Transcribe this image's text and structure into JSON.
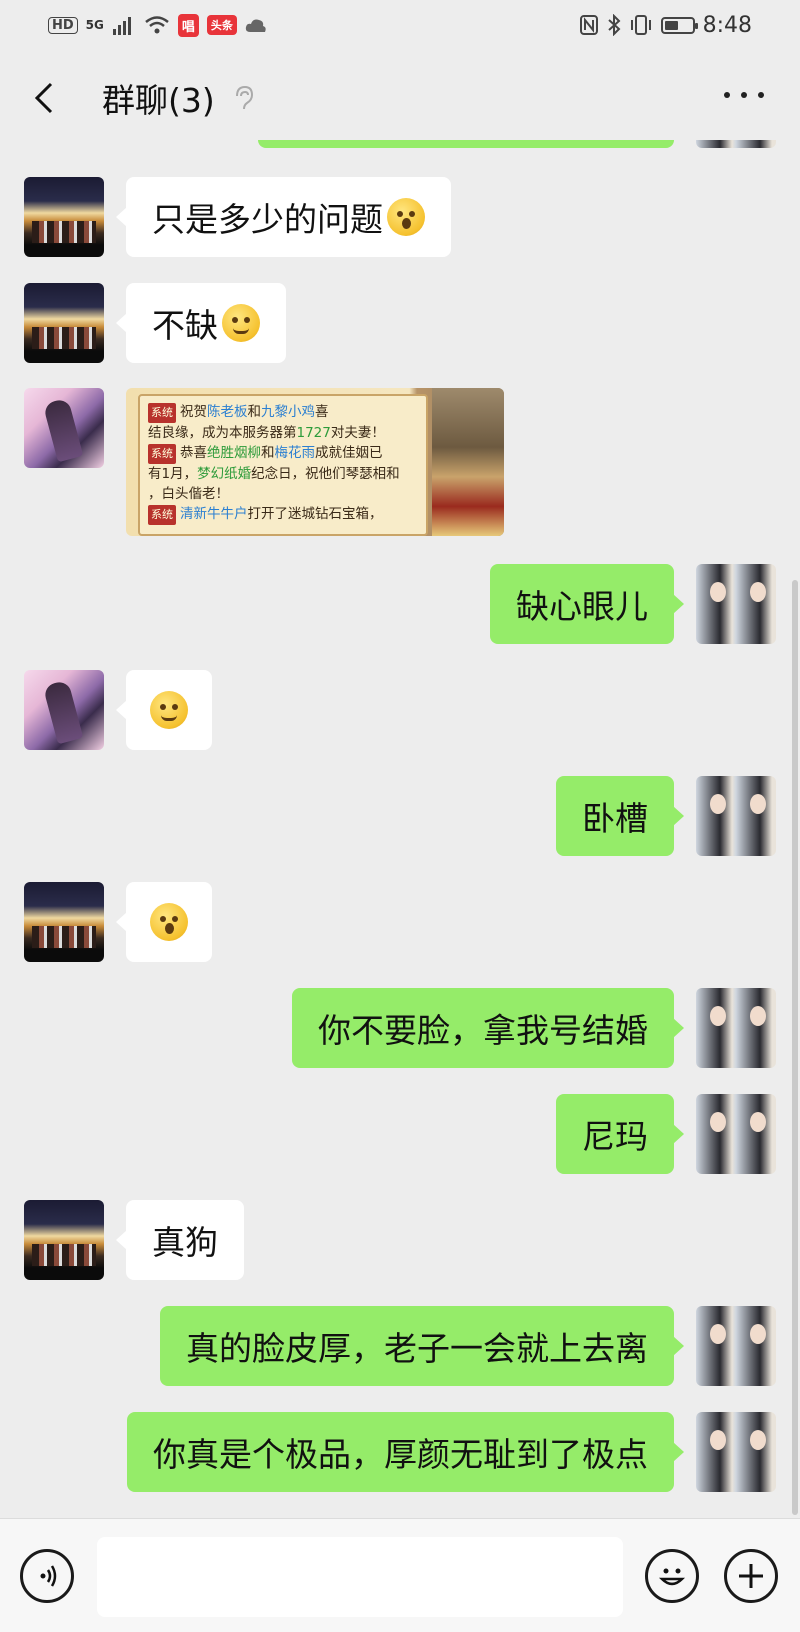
{
  "status_bar": {
    "hd": "HD",
    "net": "5G",
    "app1": "唱",
    "app2": "头条",
    "time": "8:48",
    "battery_level": 0.5
  },
  "header": {
    "title": "群聊(3)"
  },
  "messages": [
    {
      "side": "left",
      "avatar": "group-photo",
      "text": "只是多少的问题",
      "emoji": "surprised-face-icon"
    },
    {
      "side": "left",
      "avatar": "group-photo",
      "text": "不缺",
      "emoji": "smile-face-icon"
    },
    {
      "side": "left",
      "avatar": "anime-avatar",
      "type": "image",
      "image_lines": {
        "l1_tag": "系统",
        "l1a": "祝贺",
        "l1b": "陈老板",
        "l1c": "和",
        "l1d": "九黎小鸡",
        "l1e": "喜",
        "l2": "结良缘，成为本服务器第",
        "l2n": "1727",
        "l2b": "对夫妻！",
        "l3_tag": "系统",
        "l3a": "恭喜",
        "l3b": "绝胜烟柳",
        "l3c": "和",
        "l3d": "梅花雨",
        "l3e": "成就佳姻已",
        "l4a": "有1月，",
        "l4b": "梦幻纸婚",
        "l4c": "纪念日，祝他们琴瑟相和",
        "l5": "，白头偕老！",
        "l6_tag": "系统",
        "l6a": "清新牛牛户",
        "l6b": "打开了迷城钻石宝箱，"
      }
    },
    {
      "side": "right",
      "avatar": "my-avatar",
      "text": "缺心眼儿"
    },
    {
      "side": "left",
      "avatar": "anime-avatar",
      "emoji": "smirk-face-icon"
    },
    {
      "side": "right",
      "avatar": "my-avatar",
      "text": "卧槽"
    },
    {
      "side": "left",
      "avatar": "group-photo",
      "emoji": "shocked-face-icon"
    },
    {
      "side": "right",
      "avatar": "my-avatar",
      "text": "你不要脸，拿我号结婚"
    },
    {
      "side": "right",
      "avatar": "my-avatar",
      "text": "尼玛"
    },
    {
      "side": "left",
      "avatar": "group-photo",
      "text": "真狗"
    },
    {
      "side": "right",
      "avatar": "my-avatar",
      "text": "真的脸皮厚，老子一会就上去离"
    },
    {
      "side": "right",
      "avatar": "my-avatar",
      "text": "你真是个极品，厚颜无耻到了极点"
    }
  ],
  "input": {
    "value": ""
  },
  "colors": {
    "background": "#ededed",
    "bubble_green": "#95ec69",
    "bubble_white": "#ffffff"
  }
}
